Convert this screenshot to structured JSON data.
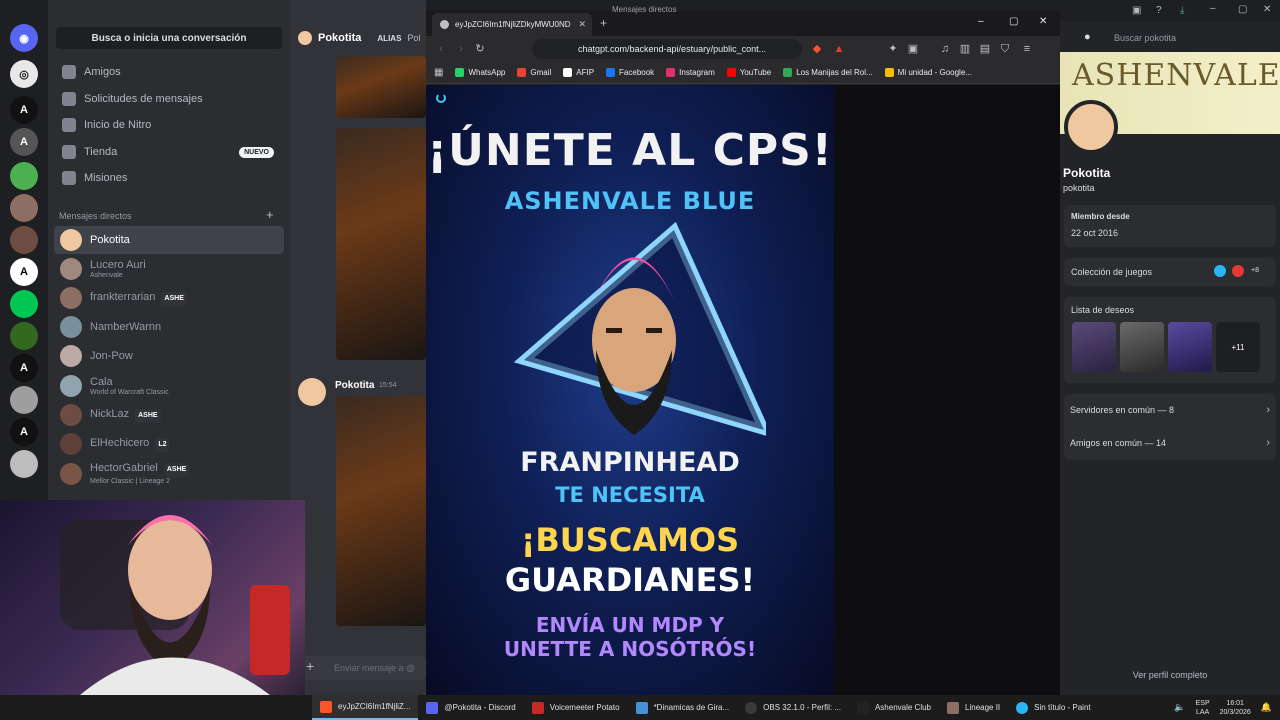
{
  "discord": {
    "search_placeholder": "Busca o inicia una conversación",
    "nav": [
      {
        "label": "Amigos",
        "icon": "friends-icon"
      },
      {
        "label": "Solicitudes de mensajes",
        "icon": "mail-icon"
      },
      {
        "label": "Inicio de Nitro",
        "icon": "nitro-icon"
      },
      {
        "label": "Tienda",
        "icon": "shop-icon",
        "badge": "NUEVO"
      },
      {
        "label": "Misiones",
        "icon": "quest-icon"
      }
    ],
    "dm_header": "Mensajes directos",
    "dms": [
      {
        "name": "Pokotita",
        "sub": "",
        "tag": ""
      },
      {
        "name": "Lucero Auri",
        "sub": "Ashenvale",
        "tag": ""
      },
      {
        "name": "frankterrarian",
        "sub": "",
        "tag": "ASHE"
      },
      {
        "name": "NamberWarnn",
        "sub": "",
        "tag": ""
      },
      {
        "name": "Jon-Pow",
        "sub": "",
        "tag": ""
      },
      {
        "name": "Cala",
        "sub": "World of Warcraft Classic",
        "tag": ""
      },
      {
        "name": "NickLaz",
        "sub": "",
        "tag": "ASHE"
      },
      {
        "name": "ElHechicero",
        "sub": "",
        "tag": "L2"
      },
      {
        "name": "HectorGabriel",
        "sub": "Mellor Classic | Lineage 2",
        "tag": "ASHE"
      }
    ],
    "chat": {
      "header_name": "Pokotita",
      "header_alias": "ALIAS",
      "header_extra": "Pol",
      "message_author": "Pokotita",
      "message_time": "15:54",
      "input_placeholder": "Enviar mensaje a @"
    },
    "profile": {
      "search_placeholder": "Buscar pokotita",
      "banner_text": "ASHENVALE",
      "display_name": "Pokotita",
      "username": "pokotita",
      "member_since_label": "Miembro desde",
      "member_since_value": "22 oct 2016",
      "games_label": "Colección de juegos",
      "games_more": "+8",
      "wishlist_label": "Lista de deseos",
      "wishlist_more": "+11",
      "servers": "Servidores en común — 8",
      "friends": "Amigos en común — 14",
      "full_profile": "Ver perfil completo"
    }
  },
  "browser": {
    "tab_title": "eyJpZCI6Im1fNjliZDkyMWU0ND",
    "url": "chatgpt.com/backend-api/estuary/public_cont...",
    "bookmarks": [
      {
        "label": "WhatsApp",
        "color": "#25d366"
      },
      {
        "label": "Gmail",
        "color": "#ea4335"
      },
      {
        "label": "AFIP",
        "color": "#ffffff"
      },
      {
        "label": "Facebook",
        "color": "#1877f2"
      },
      {
        "label": "Instagram",
        "color": "#e1306c"
      },
      {
        "label": "YouTube",
        "color": "#ff0000"
      },
      {
        "label": "Los Manijas del Rol...",
        "color": "#34a853"
      },
      {
        "label": "Mi unidad - Google...",
        "color": "#fbbc04"
      }
    ],
    "behind_window_title": "Mensajes directos"
  },
  "poster": {
    "title": "¡ÚNETE AL CPS!",
    "subtitle": "ASHENVALE BLUE",
    "name": "FRANPINHEAD",
    "needs": "TE NECESITA",
    "search": "¡BUSCAMOS",
    "guardians": "GUARDIANES!",
    "send1": "ENVÍA UN MDP Y",
    "send2": "UNETTE A NOSÓTRÓS!"
  },
  "taskbar": {
    "items": [
      {
        "label": "eyJpZCI6Im1fNjliZ...",
        "color": "#fb542b",
        "active": true
      },
      {
        "label": "@Pokotita - Discord",
        "color": "#5865f2",
        "active": false
      },
      {
        "label": "Voicemeeter Potato",
        "color": "#c62828",
        "active": false
      },
      {
        "label": "*Dinamicas de Gira...",
        "color": "#4a90d9",
        "active": false
      },
      {
        "label": "OBS 32.1.0 - Perfil: ...",
        "color": "#3a3a3a",
        "active": false
      },
      {
        "label": "Ashenvale Club",
        "color": "#222222",
        "active": false
      },
      {
        "label": "Lineage II",
        "color": "#8d6e63",
        "active": false
      },
      {
        "label": "Sin título - Paint",
        "color": "#29b6f6",
        "active": false
      }
    ],
    "lang1": "ESP",
    "lang2": "LAA",
    "time": "16:01",
    "date": "20/3/2026"
  }
}
